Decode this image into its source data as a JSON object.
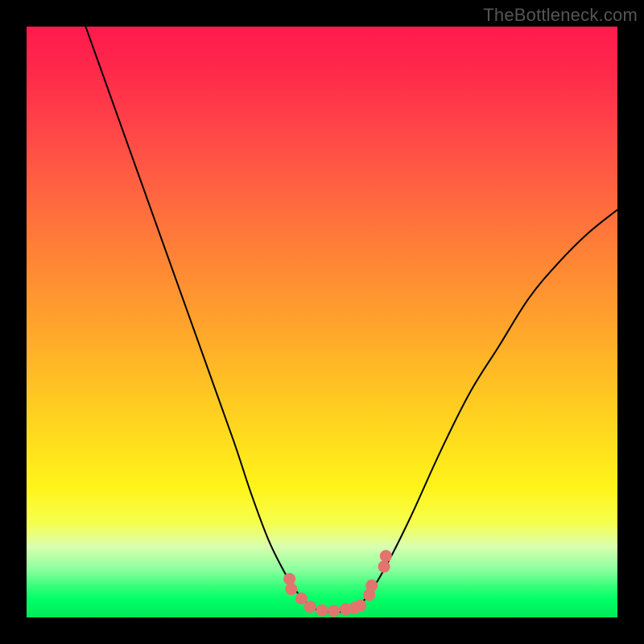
{
  "attribution": "TheBottleneck.com",
  "chart_data": {
    "type": "line",
    "title": "",
    "xlabel": "",
    "ylabel": "",
    "xlim": [
      0,
      100
    ],
    "ylim": [
      0,
      100
    ],
    "legend": false,
    "grid": false,
    "series": [
      {
        "name": "bottleneck-curve",
        "x": [
          10,
          15,
          20,
          25,
          30,
          35,
          38,
          41,
          44,
          46,
          48,
          50,
          52,
          54,
          56,
          58,
          61,
          65,
          70,
          75,
          80,
          85,
          90,
          95,
          100
        ],
        "y": [
          100,
          86,
          72,
          58,
          44,
          30,
          21,
          13,
          7,
          4,
          2,
          1,
          1,
          1,
          2,
          4,
          9,
          17,
          28,
          38,
          46,
          54,
          60,
          65,
          69
        ]
      }
    ],
    "markers": {
      "name": "bottleneck-markers",
      "x": [
        44.5,
        44.8,
        46.5,
        48,
        50,
        52,
        54,
        55.5,
        56.5,
        58,
        58.4,
        60.5,
        60.8
      ],
      "y": [
        6.5,
        4.8,
        3.2,
        1.8,
        1.2,
        1.1,
        1.4,
        1.6,
        2.0,
        3.8,
        5.4,
        8.6,
        10.4
      ]
    },
    "axes_visible": false,
    "background_gradient": [
      "#ff1a4d",
      "#ffd21f",
      "#00ff66"
    ]
  },
  "colors": {
    "frame": "#000000",
    "curve": "#000000",
    "marker": "#e2746e",
    "attribution": "#555555"
  }
}
